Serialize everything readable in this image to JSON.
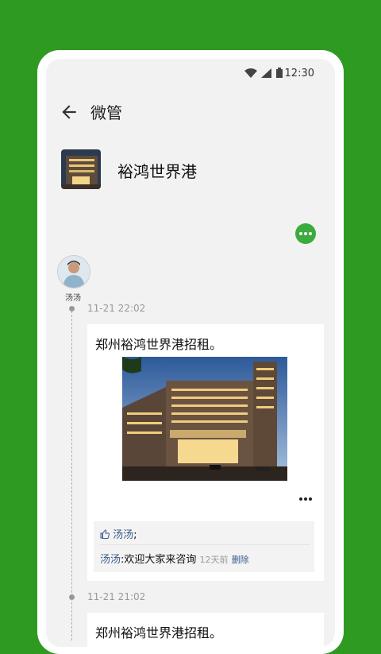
{
  "status_bar": {
    "time": "12:30"
  },
  "app_bar": {
    "title": "微管"
  },
  "profile": {
    "name": "裕鸿世界港"
  },
  "posts": [
    {
      "author": "汤汤",
      "timestamp": "11-21 22:02",
      "text": "郑州裕鸿世界港招租。",
      "likes": {
        "user": "汤汤",
        "suffix": ";"
      },
      "comment": {
        "user": "汤汤",
        "text": ":欢迎大家来咨询",
        "time": "12天前",
        "delete_label": "删除"
      }
    },
    {
      "timestamp": "11-21 21:02",
      "text": "郑州裕鸿世界港招租。"
    }
  ],
  "colors": {
    "background": "#2f9a22",
    "accent": "#3bab3e",
    "link": "#3a5a8c"
  }
}
